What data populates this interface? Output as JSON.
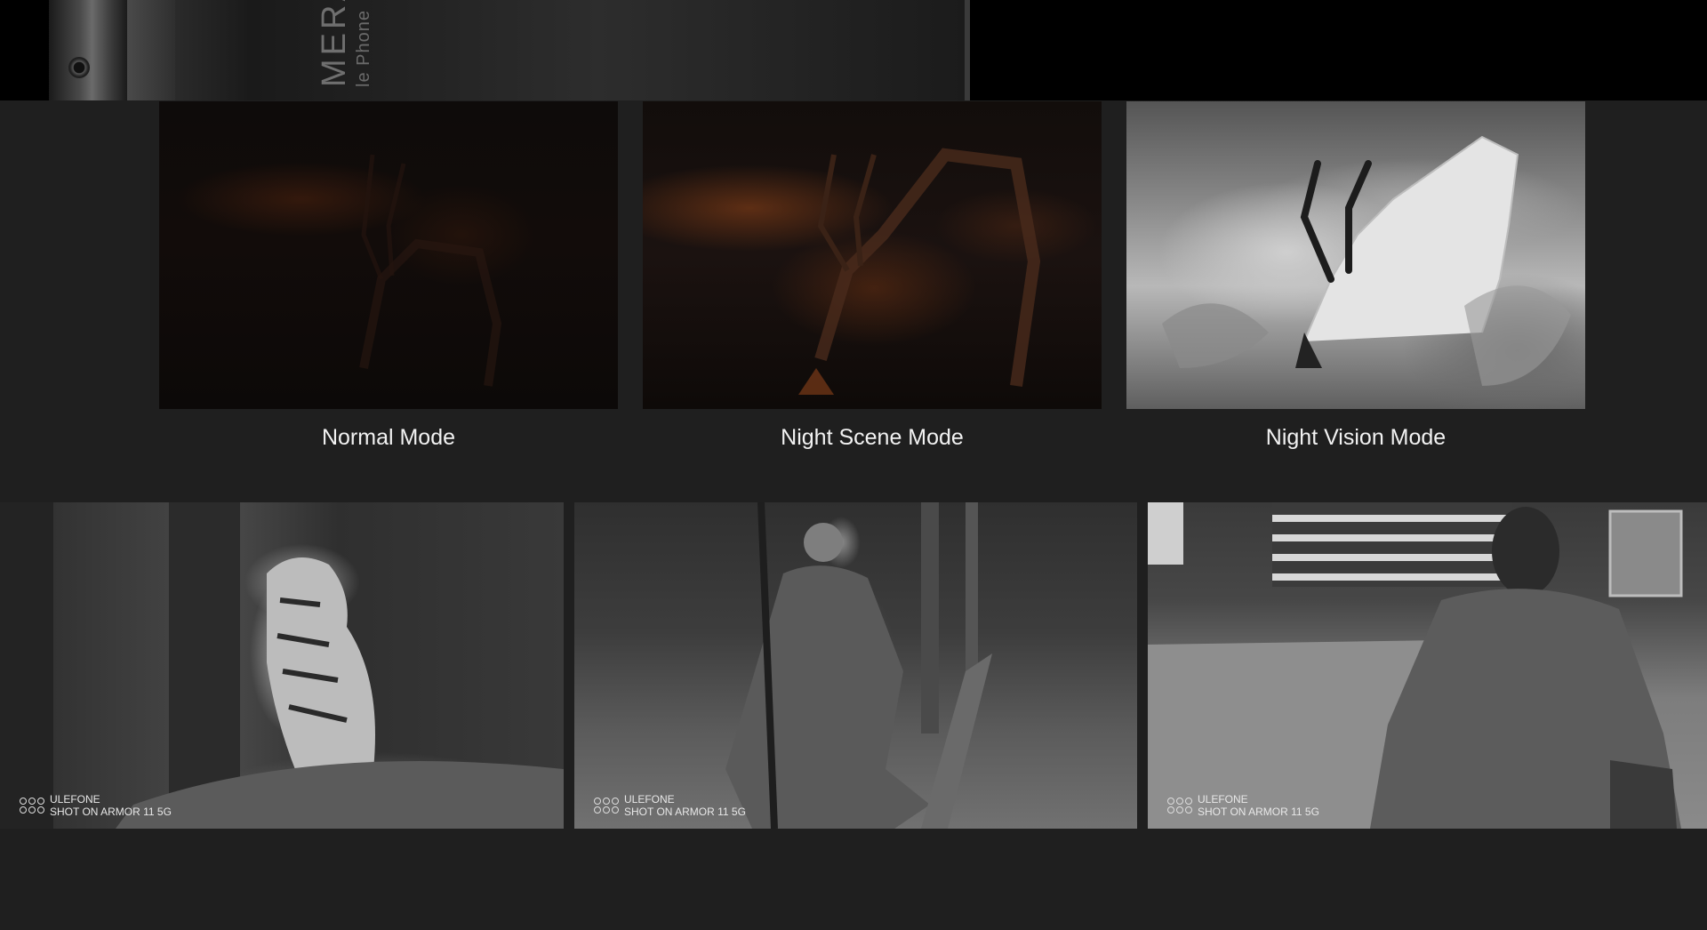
{
  "banner": {
    "phone_text_big": "MERA",
    "phone_text_small": "le Phone"
  },
  "modes": [
    {
      "label": "Normal Mode"
    },
    {
      "label": "Night Scene Mode"
    },
    {
      "label": "Night Vision Mode"
    }
  ],
  "gallery": [
    {
      "subject": "tiger",
      "watermark_brand": "ULEFONE",
      "watermark_caption": "SHOT ON ARMOR 11 5G"
    },
    {
      "subject": "hunter",
      "watermark_brand": "ULEFONE",
      "watermark_caption": "SHOT ON ARMOR 11 5G"
    },
    {
      "subject": "man",
      "watermark_brand": "ULEFONE",
      "watermark_caption": "SHOT ON ARMOR 11 5G"
    }
  ],
  "colors": {
    "page_bg": "#1f1f1f",
    "banner_bg": "#000000",
    "label_text": "#f2f2f2",
    "night_tint": "#8a3a12"
  }
}
